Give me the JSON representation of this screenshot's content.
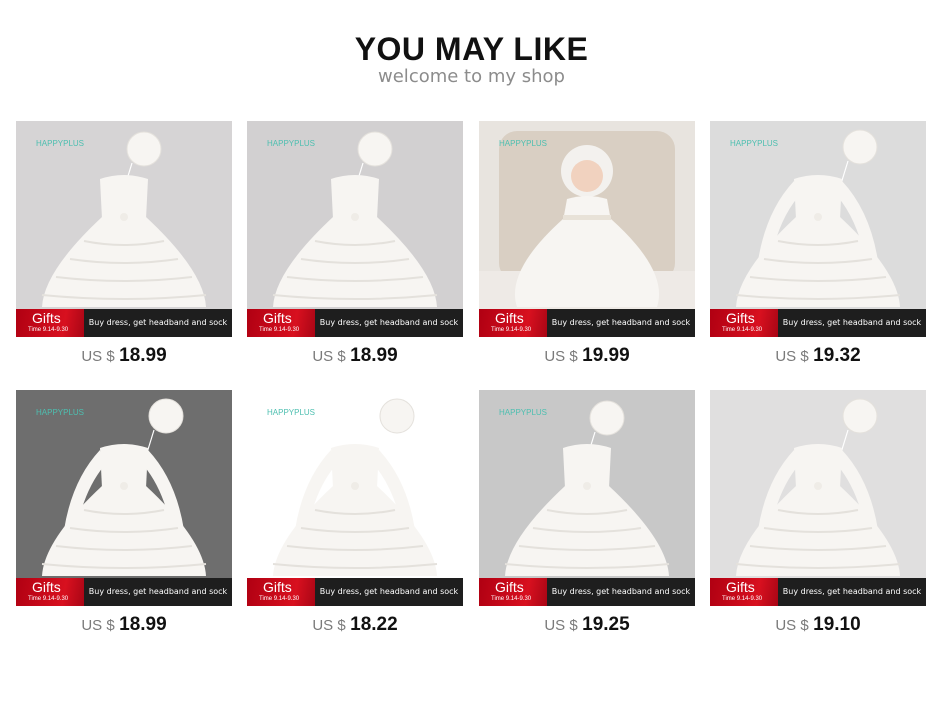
{
  "header": {
    "title": "YOU MAY LIKE",
    "subtitle": "welcome to my shop"
  },
  "promo": {
    "gift_title": "Gifts",
    "gift_date": "Time 9.14-9.30",
    "text": "Buy dress, get headband and sock"
  },
  "products": [
    {
      "brand": "HAPPYPLUS",
      "currency": "US $",
      "price": "18.99",
      "image": "sleeveless-tiered-lace-dress-with-bonnet",
      "bg": "#d6d4d5"
    },
    {
      "brand": "HAPPYPLUS",
      "currency": "US $",
      "price": "18.99",
      "image": "sleeveless-tulle-dress-with-bonnet",
      "bg": "#d2d0d1"
    },
    {
      "brand": "HAPPYPLUS",
      "currency": "US $",
      "price": "19.99",
      "image": "baby-in-christening-gown",
      "bg": "#e8e4df"
    },
    {
      "brand": "HAPPYPLUS",
      "currency": "US $",
      "price": "19.32",
      "image": "long-sleeve-lace-gown-with-bonnet",
      "bg": "#dcdcdc"
    },
    {
      "brand": "HAPPYPLUS",
      "currency": "US $",
      "price": "18.99",
      "image": "long-sleeve-tulle-dress-with-bonnet",
      "bg": "#6e6e6e"
    },
    {
      "brand": "HAPPYPLUS",
      "currency": "US $",
      "price": "18.22",
      "image": "short-sleeve-long-lace-gown",
      "bg": "#ffffff"
    },
    {
      "brand": "HAPPYPLUS",
      "currency": "US $",
      "price": "19.25",
      "image": "short-sleeve-layered-gown-with-bonnet",
      "bg": "#c8c8c8"
    },
    {
      "brand": "",
      "currency": "US $",
      "price": "19.10",
      "image": "long-sleeve-lace-tulle-dress-with-bonnet",
      "bg": "#e0dfdf"
    }
  ],
  "colors": {
    "gift_red": "#d8101f",
    "promo_bar": "#1e1e1e",
    "brand_teal": "#4dbfb0",
    "price_text": "#111111"
  }
}
